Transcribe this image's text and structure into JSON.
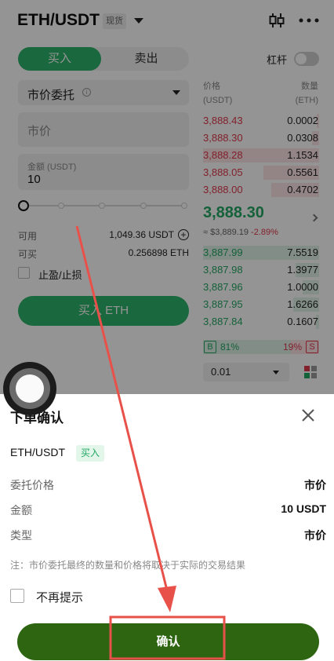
{
  "header": {
    "pair": "ETH/USDT",
    "spot_badge": "现货"
  },
  "trade": {
    "tab_buy": "买入",
    "tab_sell": "卖出",
    "leverage_label": "杠杆",
    "order_type": "市价委托",
    "order_type_info": "i",
    "price_placeholder": "市价",
    "amount_label": "金额 (USDT)",
    "amount_value": "10",
    "slider_percent": 0,
    "available_label": "可用",
    "available_value": "1,049.36 USDT",
    "buyable_label": "可买",
    "buyable_value": "0.256898 ETH",
    "tpsl_label": "止盈/止损",
    "buy_button": "买入 ETH"
  },
  "orderbook": {
    "price_header": "价格",
    "price_unit": "(USDT)",
    "qty_header": "数量",
    "qty_unit": "(ETH)",
    "asks": [
      {
        "price": "3,888.43",
        "qty": "0.0002",
        "depth": 0.02
      },
      {
        "price": "3,888.30",
        "qty": "0.0308",
        "depth": 0.06
      },
      {
        "price": "3,888.28",
        "qty": "1.1534",
        "depth": 1.0
      },
      {
        "price": "3,888.05",
        "qty": "0.5561",
        "depth": 0.48
      },
      {
        "price": "3,888.00",
        "qty": "0.4702",
        "depth": 0.41
      }
    ],
    "last_price": "3,888.30",
    "last_fiat": "≈ $3,889.19",
    "last_change": "-2.89%",
    "bids": [
      {
        "price": "3,887.99",
        "qty": "7.5519",
        "depth": 1.0
      },
      {
        "price": "3,887.98",
        "qty": "1.3977",
        "depth": 0.2
      },
      {
        "price": "3,887.96",
        "qty": "1.0000",
        "depth": 0.14
      },
      {
        "price": "3,887.95",
        "qty": "1.6266",
        "depth": 0.22
      },
      {
        "price": "3,887.84",
        "qty": "0.1607",
        "depth": 0.03
      }
    ],
    "buy_tag": "B",
    "buy_ratio": "81%",
    "sell_ratio": "19%",
    "sell_tag": "S",
    "precision": "0.01"
  },
  "sheet": {
    "title": "下单确认",
    "pair": "ETH/USDT",
    "side": "买入",
    "rows": [
      {
        "label": "委托价格",
        "value": "市价"
      },
      {
        "label": "金额",
        "value": "10 USDT"
      },
      {
        "label": "类型",
        "value": "市价"
      }
    ],
    "note": "注：市价委托最终的数量和价格将取决于实际的交易结果",
    "dont_remind": "不再提示",
    "confirm_button": "确认"
  },
  "colors": {
    "buy_green": "#2db36a",
    "sell_red": "#e0394d",
    "confirm_green": "#2d6511",
    "annotation_red": "#e8514a"
  },
  "icons": [
    "kline-icon",
    "more-icon",
    "info-icon",
    "plus-circle-icon",
    "chevron-right-icon",
    "depth-view-icon",
    "close-icon"
  ]
}
